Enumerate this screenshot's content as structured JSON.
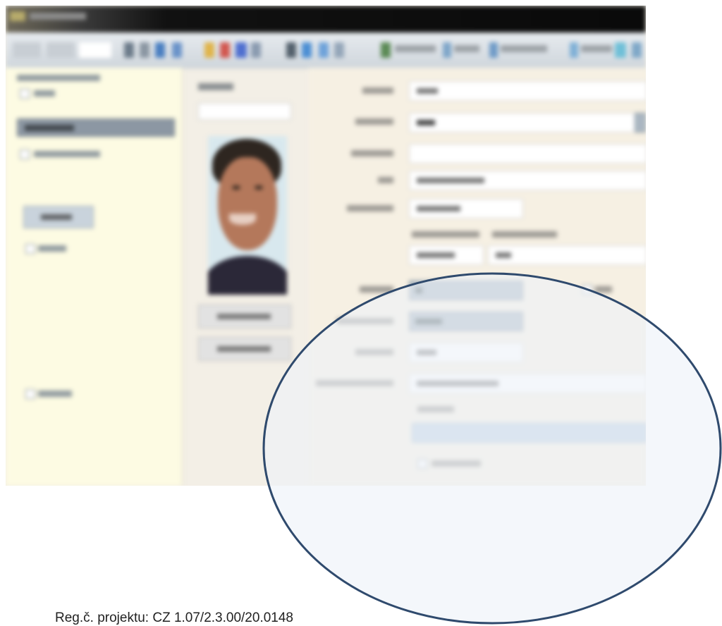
{
  "caption": "Reg.č. projektu: CZ 1.07/2.3.00/20.0148",
  "colors": {
    "circle_stroke": "#2f4a6d",
    "circle_fill": "#eef2f8",
    "left_panel": "#fdfbe3",
    "form_panel": "#f6f0e3",
    "title_bar": "#111111",
    "toolbar": "#dfe4e8"
  },
  "icons": [
    "app-icon",
    "toolbar-icons",
    "person-photo"
  ]
}
